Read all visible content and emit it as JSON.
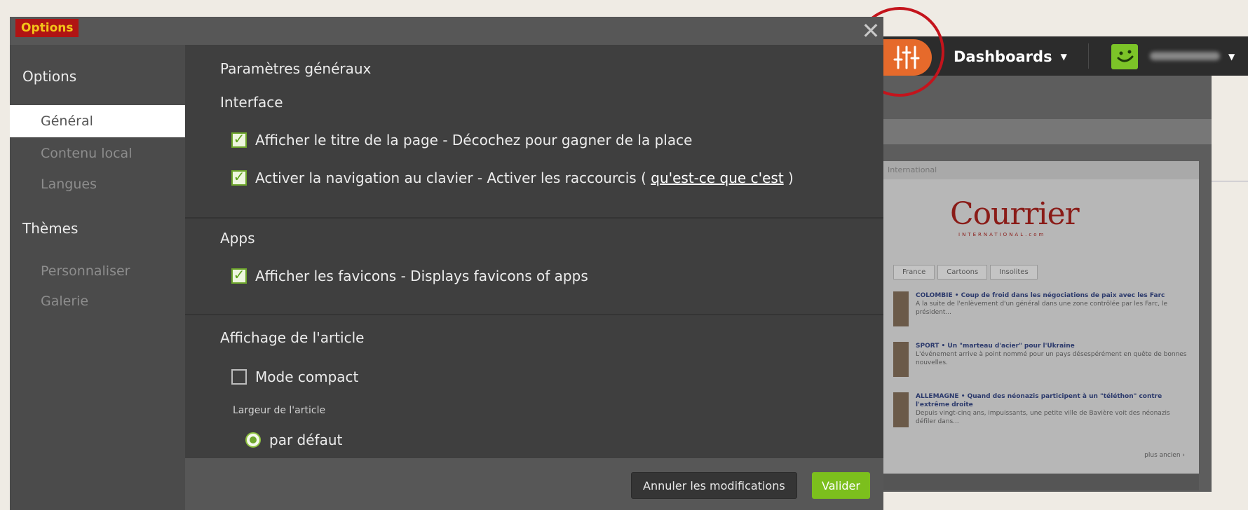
{
  "modal": {
    "title": "Options",
    "close_glyph": "✕"
  },
  "sidebar": {
    "sections": [
      {
        "heading": "Options",
        "items": [
          "Général",
          "Contenu local",
          "Langues"
        ]
      },
      {
        "heading": "Thèmes",
        "items": [
          "Personnaliser",
          "Galerie"
        ]
      }
    ],
    "active_item": "Général"
  },
  "content": {
    "page_title": "Paramètres généraux",
    "interface": {
      "title": "Interface",
      "show_title": {
        "checked": true,
        "label": "Afficher le titre de la page - Décochez pour gagner de la place"
      },
      "keyboard_nav": {
        "checked": true,
        "label": "Activer la navigation au clavier - Activer les raccourcis (",
        "link": "qu'est-ce que c'est",
        "suffix": ")"
      }
    },
    "apps": {
      "title": "Apps",
      "show_favicons": {
        "checked": true,
        "label": "Afficher les favicons - Displays favicons of apps"
      }
    },
    "article": {
      "title": "Affichage de l'article",
      "compact_mode": {
        "checked": false,
        "label": "Mode compact"
      },
      "width_label": "Largeur de l'article",
      "width_option_default": {
        "selected": true,
        "label": "par défaut"
      }
    }
  },
  "footer": {
    "cancel_label": "Annuler les modifications",
    "validate_label": "Valider"
  },
  "background_app": {
    "dashboards_label": "Dashboards",
    "widget": {
      "logo": "Courrier",
      "logo_sub": "INTERNATIONAL.com",
      "header": "International",
      "tabs": [
        "France",
        "Cartoons",
        "Insolites"
      ],
      "news": [
        {
          "headline": "COLOMBIE • Coup de froid dans les négociations de paix avec les Farc",
          "text": "A la suite de l'enlèvement d'un général dans une zone contrôlée par les Farc, le président..."
        },
        {
          "headline": "SPORT • Un \"marteau d'acier\" pour l'Ukraine",
          "text": "L'événement arrive à point nommé pour un pays désespérément en quête de bonnes nouvelles."
        },
        {
          "headline": "ALLEMAGNE • Quand des néonazis participent à un \"téléthon\" contre l'extrême droite",
          "text": "Depuis vingt-cinq ans, impuissants, une petite ville de Bavière voit des néonazis défiler dans..."
        }
      ],
      "more": "plus ancien ›"
    }
  },
  "colors": {
    "accent_green": "#7cbf1d",
    "title_red": "#b01414",
    "title_yellow": "#f3c419",
    "logo_orange": "#e66a2b"
  }
}
